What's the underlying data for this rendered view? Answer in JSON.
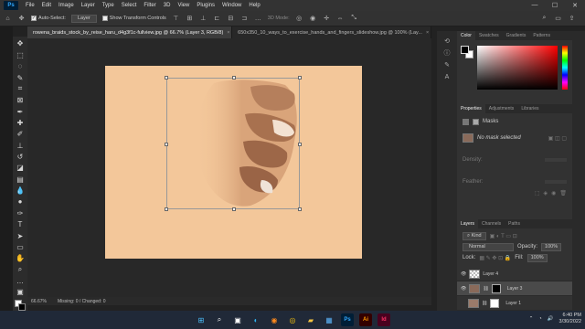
{
  "menu": {
    "logo": "Ps",
    "items": [
      "File",
      "Edit",
      "Image",
      "Layer",
      "Type",
      "Select",
      "Filter",
      "3D",
      "View",
      "Plugins",
      "Window",
      "Help"
    ],
    "window_controls": [
      "—",
      "☐",
      "✕"
    ]
  },
  "options": {
    "auto_select_label": "Auto-Select:",
    "auto_select_target": "Layer",
    "transform_controls_label": "Show Transform Controls",
    "mode_3d": "3D Mode:"
  },
  "tabs": [
    {
      "label": "rowena_braids_stock_by_reise_haru_d4g3f1c-fullview.jpg @ 66.7% (Layer 3, RGB/8)",
      "close": "×",
      "active": true
    },
    {
      "label": "650x350_10_ways_to_exercise_hands_and_fingers_slideshow.jpg @ 100% (Lay...",
      "close": "×",
      "active": false
    }
  ],
  "status": {
    "zoom": "66.67%",
    "info": "Missing: 0 / Changed: 0"
  },
  "color_panel": {
    "tabs": [
      "Color",
      "Swatches",
      "Gradients",
      "Patterns"
    ],
    "foreground": "#000000",
    "background": "#ffffff"
  },
  "properties_panel": {
    "tabs": [
      "Properties",
      "Adjustments",
      "Libraries"
    ],
    "section": "Masks",
    "no_mask": "No mask selected",
    "density_label": "Density:",
    "feather_label": "Feather:"
  },
  "layers_panel": {
    "tabs": [
      "Layers",
      "Channels",
      "Paths"
    ],
    "kind_filter": "Kind",
    "blend_mode": "Normal",
    "opacity_label": "Opacity:",
    "opacity_value": "100%",
    "lock_label": "Lock:",
    "fill_label": "Fill:",
    "fill_value": "100%",
    "layers": [
      {
        "name": "Layer 4",
        "selected": false
      },
      {
        "name": "Layer 3",
        "selected": true
      },
      {
        "name": "Layer 1",
        "selected": false
      }
    ]
  },
  "taskbar": {
    "time": "6:40 PM",
    "date": "3/30/2022",
    "apps": [
      "windows-icon",
      "search-icon",
      "task-view-icon",
      "edge-icon",
      "firefox-icon",
      "chrome-icon",
      "files-icon",
      "store-icon",
      "photoshop-icon",
      "illustrator-icon",
      "indesign-icon"
    ]
  }
}
